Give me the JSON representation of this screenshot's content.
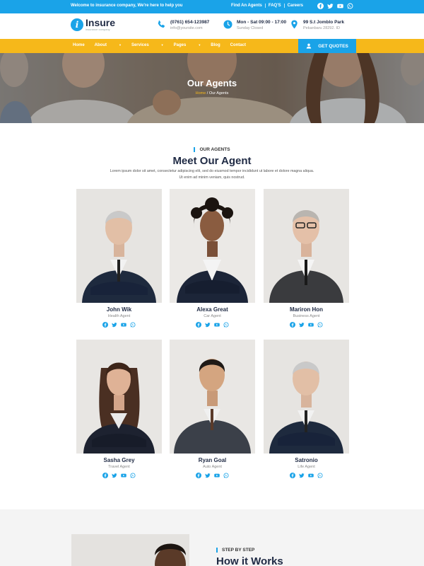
{
  "topbar": {
    "welcome": "Welcome to insurance company, We're here to help you",
    "links": [
      "Find An Agents",
      "FAQ'S",
      "Careers"
    ]
  },
  "header": {
    "brand": "Insure",
    "tagline": "insurance company",
    "phone": "(0761) 654-123987",
    "email": "info@yoursite.com",
    "hours": "Mon - Sat 09:00 - 17:00",
    "hours_note": "Sunday Closed",
    "address": "99 S.t Jomblo Park",
    "city": "Pekanbaru 28292. ID"
  },
  "nav": {
    "items": [
      "Home",
      "About",
      "Services",
      "Pages",
      "Blog",
      "Contact"
    ],
    "cta": "GET QUOTES"
  },
  "hero": {
    "title": "Our Agents",
    "crumb_home": "Home",
    "crumb_sep": " / ",
    "crumb_current": "Our Agents"
  },
  "section": {
    "eyebrow": "OUR AGENTS",
    "title": "Meet Our Agent",
    "desc1": "Lorem ipsum dolor sit amet, consectetur adipiscing elit, sed do eiusmod tempor incididunt ut labore et dolore magna aliqua.",
    "desc2": "Ut enim ad minim veniam, quis nostrud."
  },
  "agents": [
    {
      "name": "John Wik",
      "role": "Health Agent"
    },
    {
      "name": "Alexa Great",
      "role": "Car Agent"
    },
    {
      "name": "Mariron Hon",
      "role": "Business Agent"
    },
    {
      "name": "Sasha Grey",
      "role": "Travel Agent"
    },
    {
      "name": "Ryan Goal",
      "role": "Auto Agent"
    },
    {
      "name": "Satronio",
      "role": "Life Agent"
    }
  ],
  "how": {
    "eyebrow": "STEP BY STEP",
    "title": "How it Works"
  },
  "colors": {
    "primary": "#1aa3e8",
    "accent": "#f6b81a",
    "navy": "#1f2a44"
  },
  "icons": {
    "social": [
      "facebook-icon",
      "twitter-icon",
      "youtube-icon",
      "whatsapp-icon"
    ]
  }
}
